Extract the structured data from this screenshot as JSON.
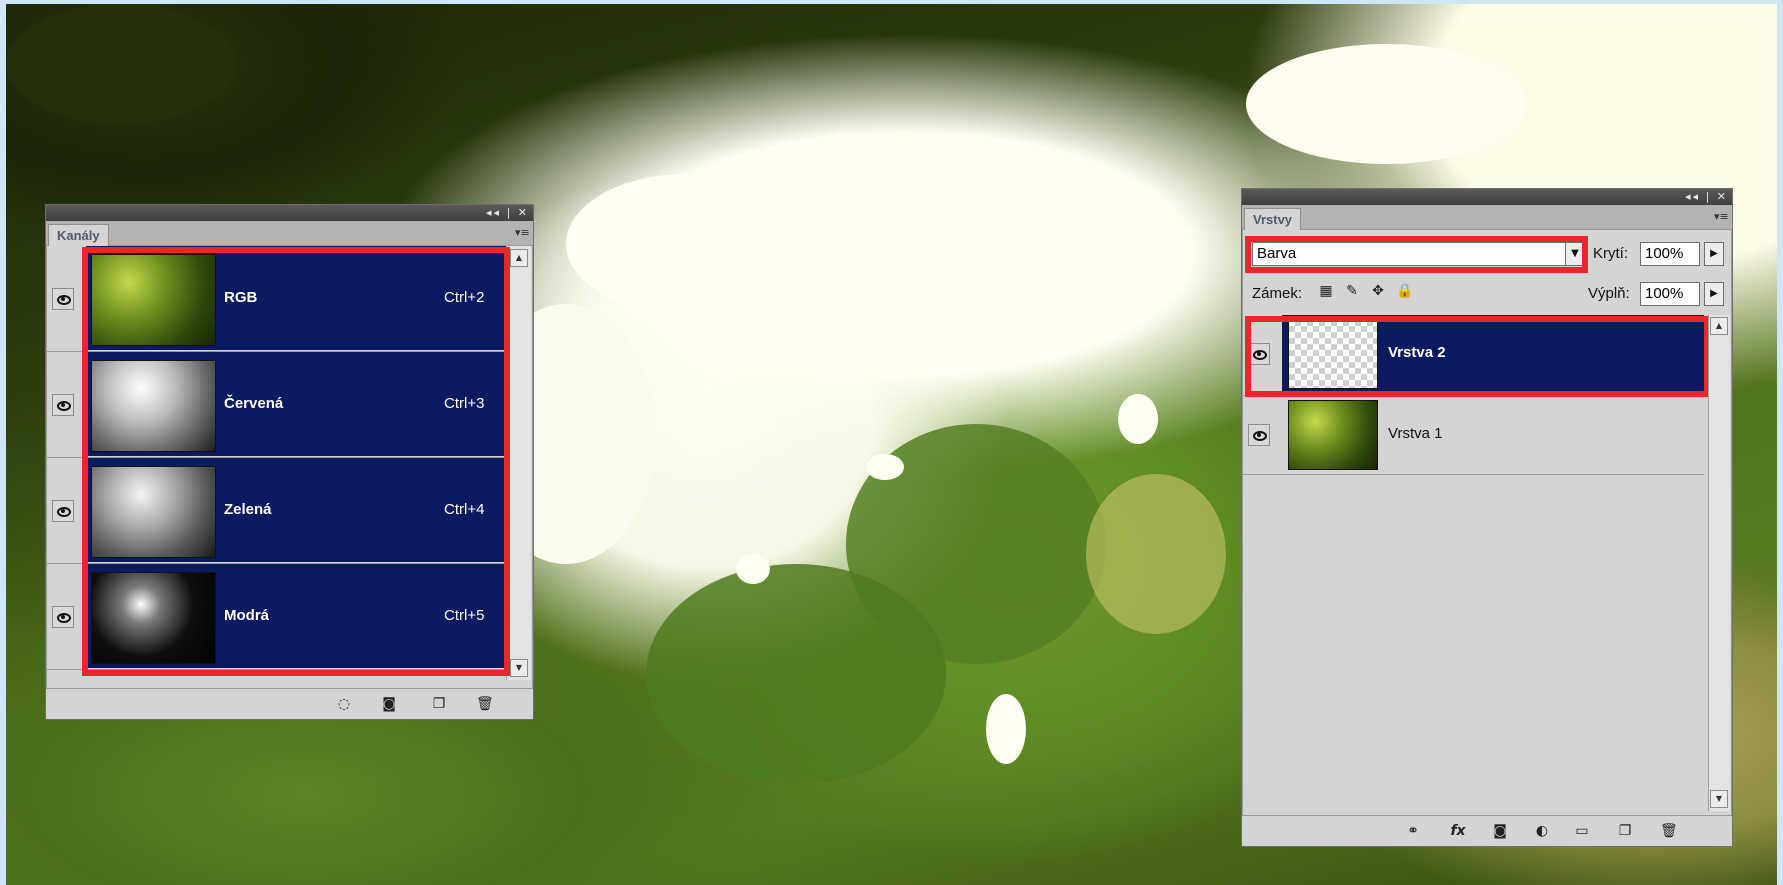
{
  "channels_panel": {
    "tab_label": "Kanály",
    "rows": [
      {
        "name": "RGB",
        "shortcut": "Ctrl+2"
      },
      {
        "name": "Červená",
        "shortcut": "Ctrl+3"
      },
      {
        "name": "Zelená",
        "shortcut": "Ctrl+4"
      },
      {
        "name": "Modrá",
        "shortcut": "Ctrl+5"
      }
    ],
    "footer_icons": [
      "load-selection-icon",
      "save-selection-icon",
      "new-channel-icon",
      "trash-icon"
    ]
  },
  "layers_panel": {
    "tab_label": "Vrstvy",
    "blend_mode": "Barva",
    "opacity_label": "Krytí:",
    "opacity_value": "100%",
    "lock_label": "Zámek:",
    "fill_label": "Výplň:",
    "fill_value": "100%",
    "layers": [
      {
        "name": "Vrstva 2",
        "selected": true
      },
      {
        "name": "Vrstva 1",
        "selected": false
      }
    ],
    "footer_icons": [
      "link-icon",
      "fx-icon",
      "mask-icon",
      "adjustment-icon",
      "group-folder-icon",
      "new-layer-icon",
      "trash-icon"
    ]
  },
  "colors": {
    "selection": "#0c1a62",
    "highlight_box": "#e8262c",
    "panel_bg": "#d4d4d4"
  }
}
